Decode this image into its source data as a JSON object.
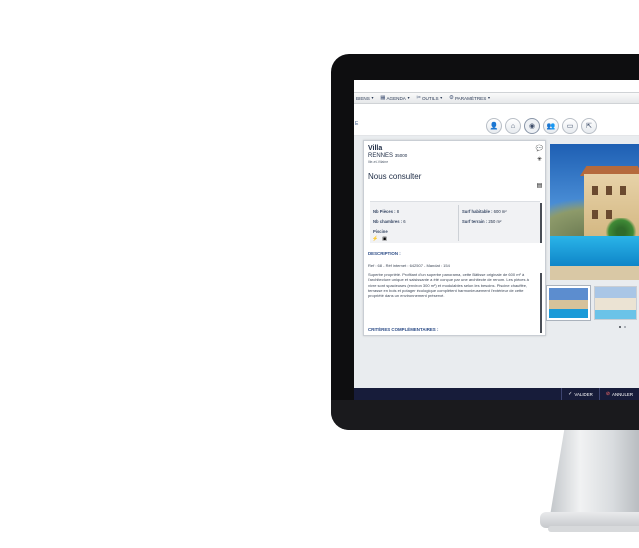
{
  "menu": {
    "items": [
      {
        "label": "BIENS",
        "icon": ""
      },
      {
        "label": "AGENDA",
        "icon": "calendar-icon"
      },
      {
        "label": "OUTILS",
        "icon": "tools-icon"
      },
      {
        "label": "PARAMÈTRES",
        "icon": "gear-icon"
      }
    ]
  },
  "subbar": {
    "left_letter": "E"
  },
  "listing": {
    "type": "Villa",
    "city": "RENNES",
    "zip": "35000",
    "department": "Ille-et-Vilaine",
    "price": "Nous consulter",
    "specs": {
      "pieces_label": "Nb Pièces :",
      "pieces_value": "8",
      "chambres_label": "Nb chambres :",
      "chambres_value": "6",
      "piscine_label": "Piscine",
      "surf_hab_label": "Surf habitable :",
      "surf_hab_value": "600 m²",
      "surf_terrain_label": "Surf terrain :",
      "surf_terrain_value": "250 m²"
    },
    "description_title": "DESCRIPTION :",
    "ref_line": "Ref : 68 - Réf internet : 642507 - Mandat : 154",
    "description": "Superbe propriété. Profitant d'un superbe panorama, cette Bâtisse originale de 600 m² à l'architecture unique et saisissante a été conçue par une architecte de renom. Les pièces à vivre sont spacieuses (environ 300 m²) et modulables selon les besoins. Piscine chauffée, terrasse en bois et potager écologique complètent harmonieusement l'extérieur de cette propriété dans un environnement préservé.",
    "criteria_title": "CRITÈRES COMPLÉMENTAIRES :"
  },
  "footer": {
    "validate_label": "VALIDER",
    "cancel_label": "ANNULER"
  },
  "colors": {
    "footer_bg": "#171c3a",
    "section_title": "#2b4b86"
  }
}
